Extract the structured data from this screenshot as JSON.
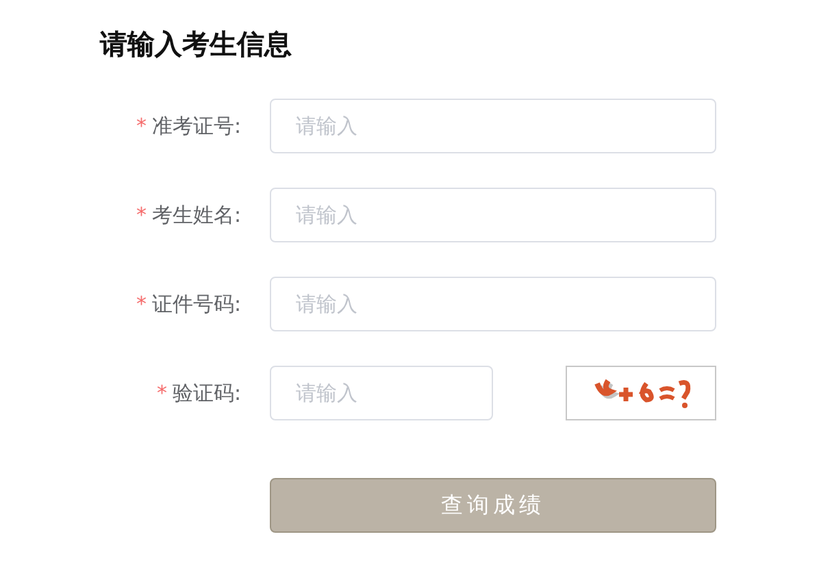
{
  "title": "请输入考生信息",
  "fields": [
    {
      "kind": "text",
      "required_mark": "*",
      "label": "准考证号:",
      "placeholder": "请输入"
    },
    {
      "kind": "text",
      "required_mark": "*",
      "label": "考生姓名:",
      "placeholder": "请输入"
    },
    {
      "kind": "text",
      "required_mark": "*",
      "label": "证件号码:",
      "placeholder": "请输入"
    },
    {
      "kind": "captcha",
      "required_mark": "*",
      "label": "验证码:",
      "placeholder": "请输入"
    }
  ],
  "submit": {
    "label": "查询成绩"
  }
}
